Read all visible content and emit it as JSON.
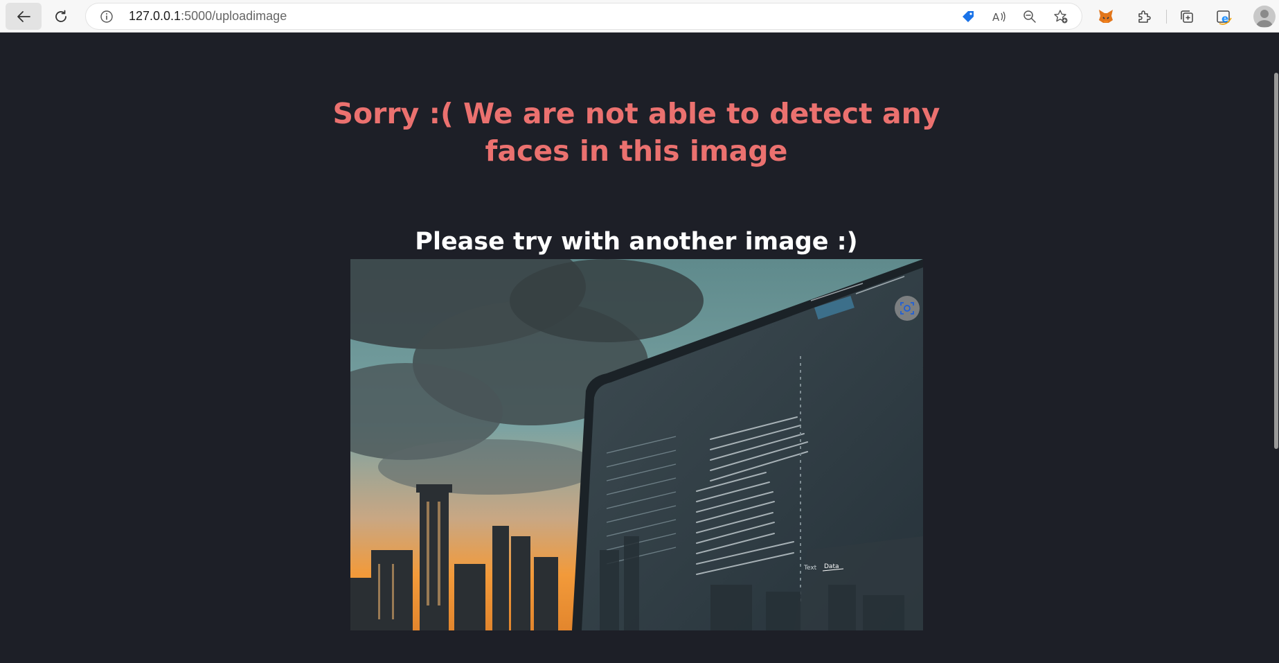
{
  "browser": {
    "url_host": "127.0.0.1",
    "url_rest": ":5000/uploadimage",
    "icons": [
      "back-arrow-icon",
      "reload-icon",
      "info-icon",
      "price-tag-icon",
      "read-aloud-icon",
      "zoom-out-icon",
      "add-favorite-icon",
      "metamask-fox-icon",
      "extensions-puzzle-icon",
      "collections-icon",
      "internet-explorer-mode-icon",
      "profile-avatar-icon"
    ]
  },
  "page": {
    "heading": "Sorry :( We are not able to detect any faces in this image",
    "subheading": "Please try with another image :)",
    "photo_tabs": [
      "Text",
      "Data"
    ]
  },
  "colors": {
    "background": "#1d1f27",
    "heading": "#eb716f",
    "subheading": "#ffffff"
  }
}
